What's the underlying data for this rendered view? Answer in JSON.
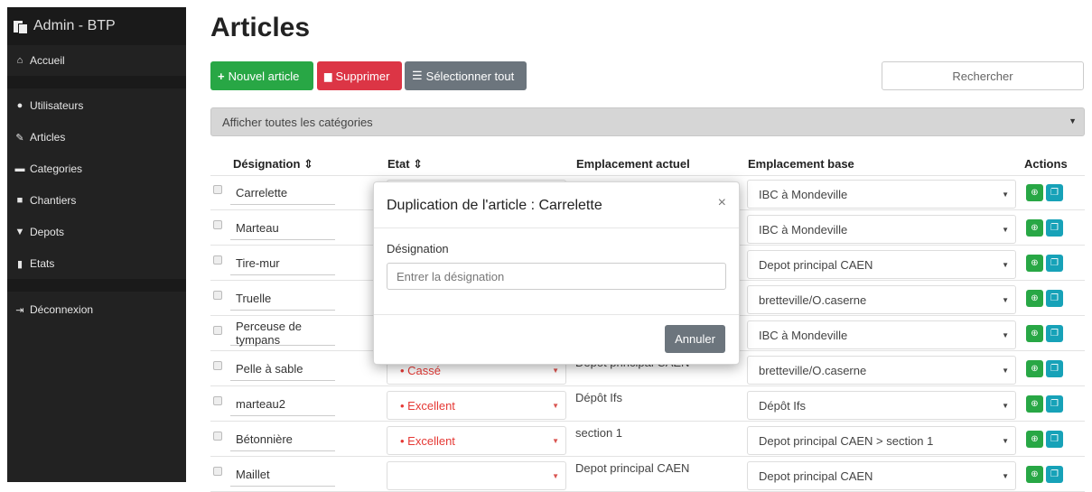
{
  "sidebar": {
    "brand": "Admin - BTP",
    "items": [
      {
        "label": "Accueil",
        "icon": "home-icon"
      },
      {
        "label": "Utilisateurs",
        "icon": "user-icon"
      },
      {
        "label": "Articles",
        "icon": "wrench-icon"
      },
      {
        "label": "Categories",
        "icon": "folder-icon"
      },
      {
        "label": "Chantiers",
        "icon": "truck-icon"
      },
      {
        "label": "Depots",
        "icon": "map-marker-icon"
      },
      {
        "label": "Etats",
        "icon": "file-icon"
      },
      {
        "label": "Déconnexion",
        "icon": "sign-out-icon"
      }
    ]
  },
  "page": {
    "title": "Articles",
    "new_label": "Nouvel article",
    "delete_label": "Supprimer",
    "select_all_label": "Sélectionner tout",
    "search_placeholder": "Rechercher",
    "category_filter": "Afficher toutes les catégories"
  },
  "table": {
    "headers": [
      "Désignation ⇕",
      "Etat ⇕",
      "Emplacement actuel",
      "Emplacement base",
      "Actions"
    ],
    "rows": [
      {
        "designation": "Carrelette",
        "etat": "",
        "actuel": "",
        "base": "IBC à Mondeville"
      },
      {
        "designation": "Marteau",
        "etat": "",
        "actuel": "",
        "base": "IBC à Mondeville"
      },
      {
        "designation": "Tire-mur",
        "etat": "",
        "actuel": "",
        "base": "Depot principal CAEN"
      },
      {
        "designation": "Truelle",
        "etat": "",
        "actuel": "",
        "base": "bretteville/O.caserne"
      },
      {
        "designation": "Perceuse de tympans",
        "etat": "",
        "actuel": "",
        "base": "IBC à Mondeville"
      },
      {
        "designation": "Pelle à sable",
        "etat": "• Cassé",
        "actuel": "Depot principal CAEN",
        "base": "bretteville/O.caserne"
      },
      {
        "designation": "marteau2",
        "etat": "• Excellent",
        "actuel": "Dépôt Ifs",
        "base": "Dépôt Ifs"
      },
      {
        "designation": "Bétonnière",
        "etat": "• Excellent",
        "actuel": "section 1",
        "base": "Depot principal CAEN > section 1"
      },
      {
        "designation": "Maillet",
        "etat": "",
        "actuel": "Depot principal CAEN",
        "base": "Depot principal CAEN"
      }
    ]
  },
  "modal": {
    "title": "Duplication de l'article : Carrelette",
    "close": "×",
    "label": "Désignation",
    "placeholder": "Entrer la désignation",
    "cancel": "Annuler"
  },
  "colors": {
    "sidebar": "#222222",
    "success": "#28a745",
    "danger": "#dc3545",
    "secondary": "#6c757d",
    "info": "#17a2b8"
  }
}
